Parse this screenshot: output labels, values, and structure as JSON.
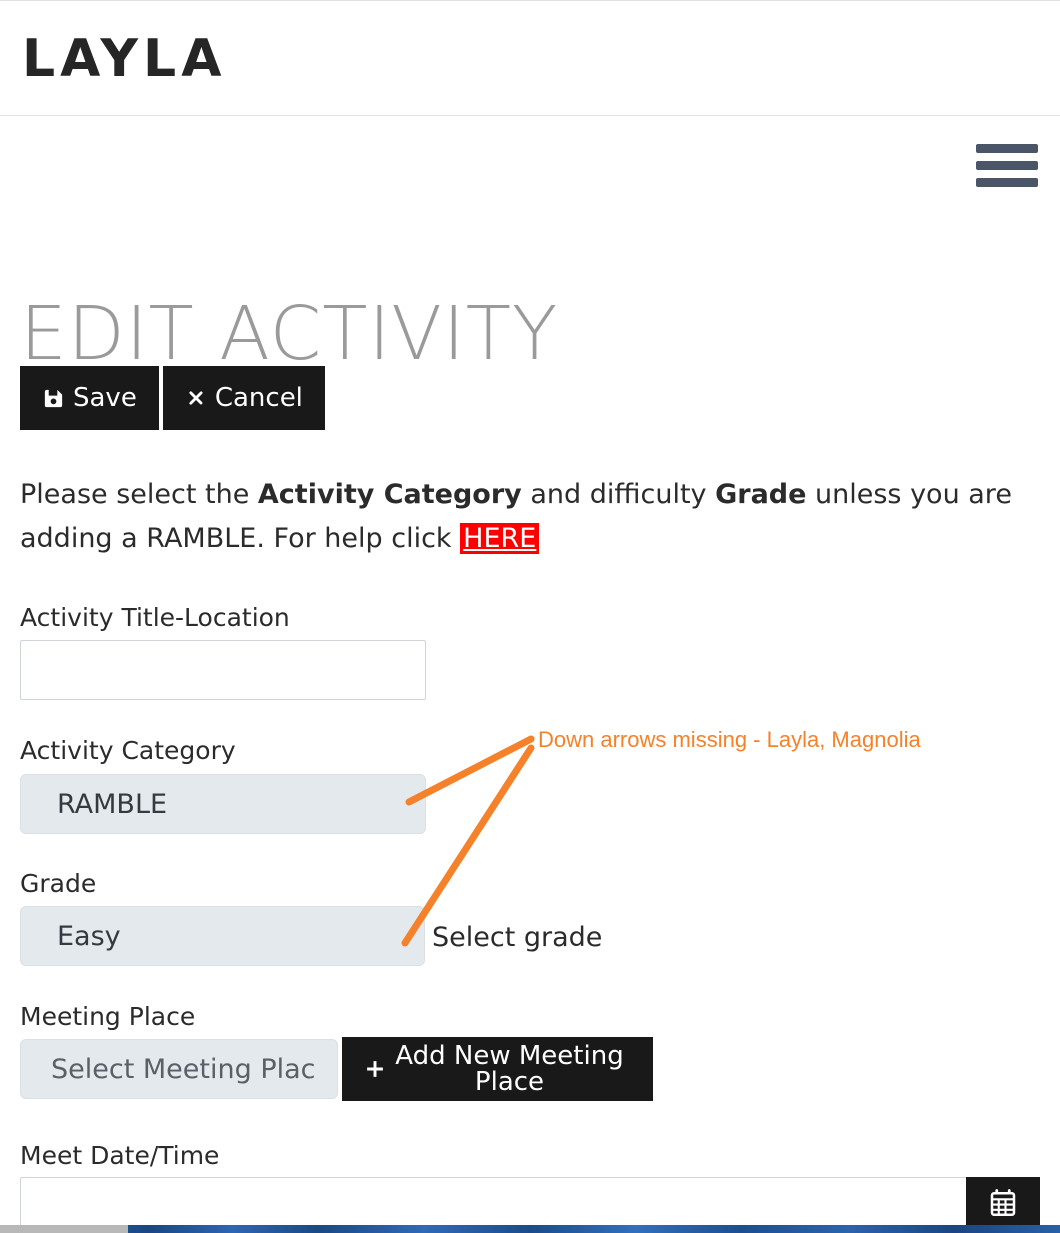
{
  "header": {
    "logo_text": "LAYLA",
    "menu_icon": "hamburger-menu-icon"
  },
  "page": {
    "title": "EDIT ACTIVITY"
  },
  "toolbar": {
    "save_label": "Save",
    "save_icon": "floppy-disk-save-icon",
    "cancel_label": "Cancel",
    "cancel_icon": "close-x-icon"
  },
  "instructions": {
    "part1": "Please select the ",
    "bold1": "Activity Category",
    "part2": " and difficulty ",
    "bold2": "Grade",
    "part3": " unless you are adding a RAMBLE. For help click ",
    "link_label": "HERE",
    "link_bg_color": "#ff0000"
  },
  "form": {
    "activity_title": {
      "label": "Activity Title-Location",
      "value": "",
      "placeholder": ""
    },
    "activity_category": {
      "label": "Activity Category",
      "selected": "RAMBLE"
    },
    "grade": {
      "label": "Grade",
      "selected": "Easy",
      "note": "Select grade"
    },
    "meeting_place": {
      "label": "Meeting Place",
      "selected": "Select Meeting Plac",
      "add_button_label": "Add New Meeting Place",
      "add_button_icon": "plus-icon"
    },
    "meet_date_time": {
      "label": "Meet Date/Time",
      "value": "",
      "calendar_icon": "calendar-icon"
    }
  },
  "annotation": {
    "text": "Down arrows missing - Layla, Magnolia",
    "color": "#f5822a"
  }
}
